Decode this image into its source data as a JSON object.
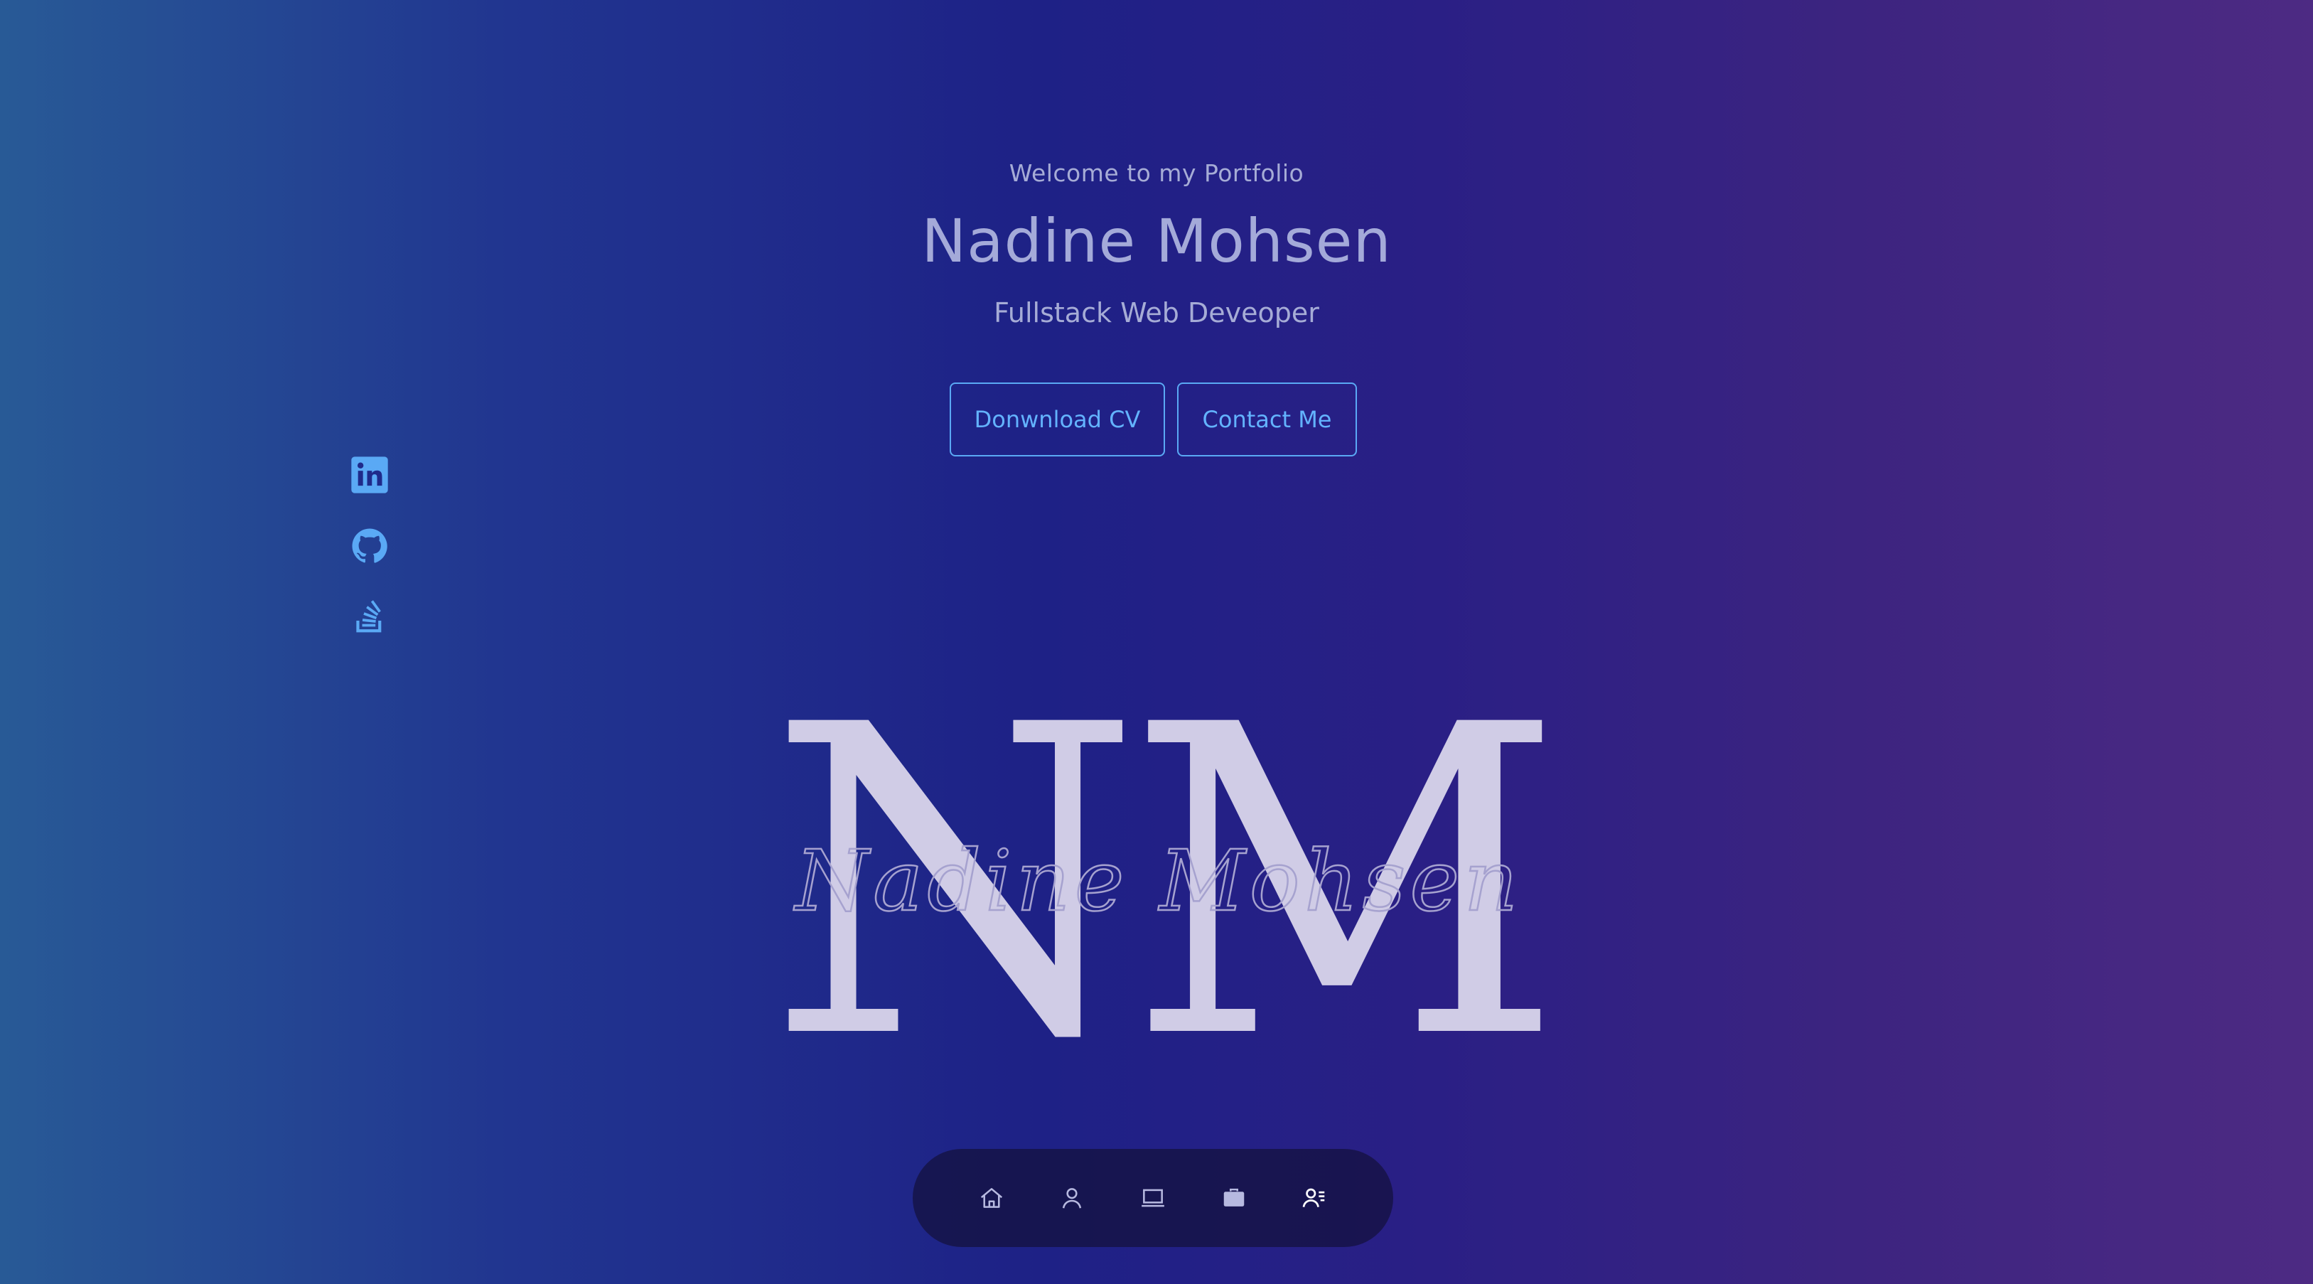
{
  "hero": {
    "welcome": "Welcome to my Portfolio",
    "name": "Nadine Mohsen",
    "role": "Fullstack Web Deveoper",
    "buttons": {
      "download_cv": "Donwnload CV",
      "contact": "Contact Me"
    }
  },
  "social": [
    {
      "icon": "linkedin-icon"
    },
    {
      "icon": "github-icon"
    },
    {
      "icon": "stackoverflow-icon"
    }
  ],
  "logo": {
    "letters": "NM",
    "signature": "Nadine Mohsen"
  },
  "dock": {
    "items": [
      {
        "icon": "home-icon"
      },
      {
        "icon": "user-icon"
      },
      {
        "icon": "laptop-icon"
      },
      {
        "icon": "briefcase-icon"
      },
      {
        "icon": "contact-list-icon",
        "active": true
      }
    ]
  },
  "colors": {
    "accent": "#63b3ff",
    "text_muted": "#a6acd6",
    "dock_bg": "#14103c",
    "logo": "#d0cce6"
  }
}
